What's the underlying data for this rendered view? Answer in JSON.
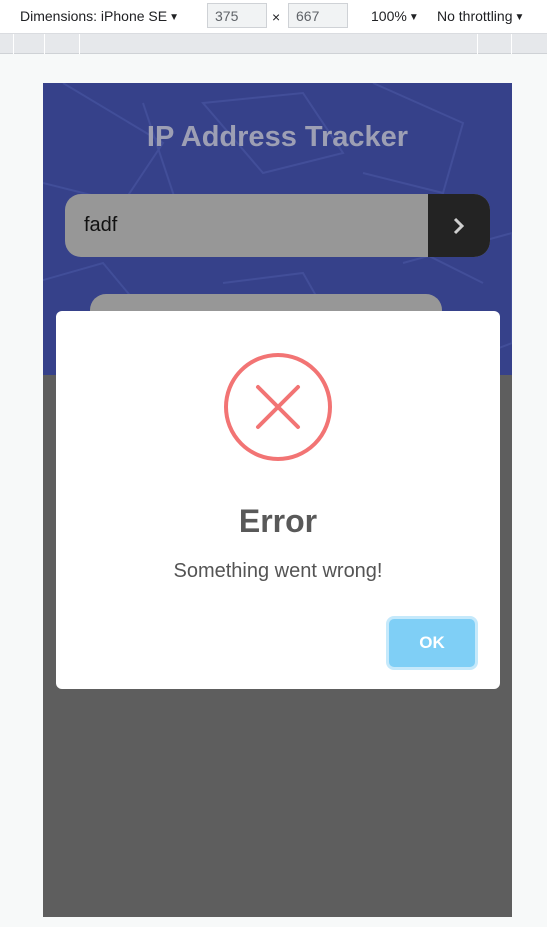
{
  "devtools": {
    "dimensions_label": "Dimensions: iPhone SE",
    "width_value": "375",
    "times_sign": "×",
    "height_value": "667",
    "zoom": "100%",
    "throttling": "No throttling",
    "caret": "▼"
  },
  "app": {
    "title": "IP Address Tracker",
    "search_value": "fadf",
    "submit_icon": "chevron-right-icon"
  },
  "modal": {
    "icon": "error-x-icon",
    "title": "Error",
    "message": "Something went wrong!",
    "ok_label": "OK"
  },
  "colors": {
    "hero": "#36418a",
    "overlay": "#5e5e5e",
    "error_red": "#f27474",
    "ok_button": "#7fcff6"
  }
}
